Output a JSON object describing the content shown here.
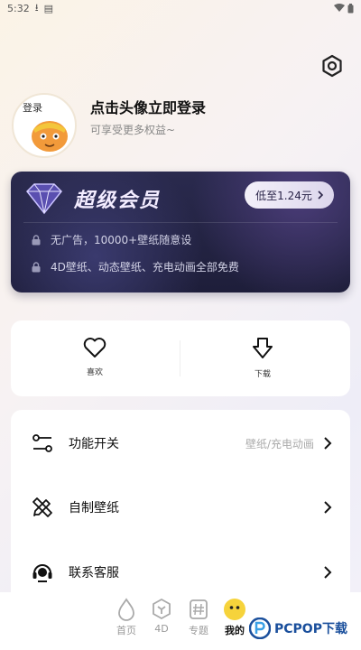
{
  "status_bar": {
    "time": "5:32"
  },
  "profile": {
    "title": "点击头像立即登录",
    "subtitle": "可享受更多权益~",
    "avatar_sign": "登录"
  },
  "vip": {
    "title": "超级会员",
    "price_label": "低至1.24元",
    "features": [
      "无广告，10000+壁纸随意设",
      "4D壁纸、动态壁纸、充电动画全部免费"
    ]
  },
  "quick": {
    "like_label": "喜欢",
    "download_label": "下载"
  },
  "menu": [
    {
      "label": "功能开关",
      "value": "壁纸/充电动画"
    },
    {
      "label": "自制壁纸",
      "value": ""
    },
    {
      "label": "联系客服",
      "value": ""
    }
  ],
  "tabs": [
    {
      "label": "首页"
    },
    {
      "label": "4D"
    },
    {
      "label": "专题"
    },
    {
      "label": "我的"
    }
  ],
  "watermark": {
    "text": "PCPOP下载"
  },
  "colors": {
    "vip_bg": "#23234a",
    "accent_yellow": "#f6d33b",
    "watermark_blue": "#1a4f9c"
  }
}
